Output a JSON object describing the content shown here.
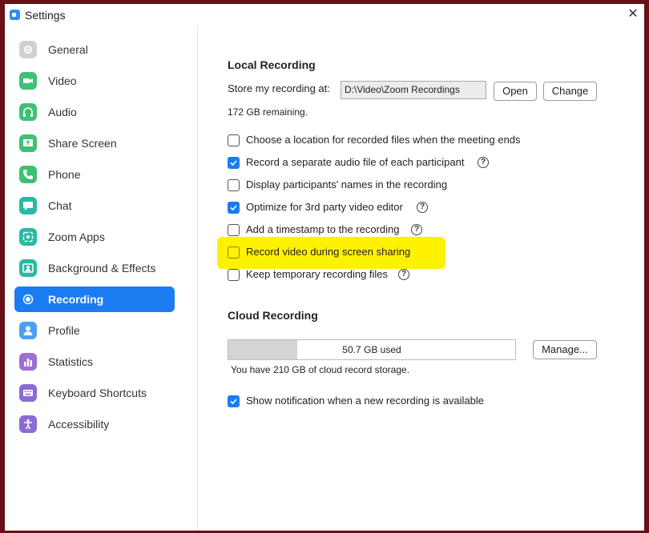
{
  "window": {
    "title": "Settings",
    "close_symbol": "✕"
  },
  "sidebar": {
    "items": [
      {
        "label": "General",
        "icon": "gear-icon",
        "color": "#c9c9c9"
      },
      {
        "label": "Video",
        "icon": "video-camera-icon",
        "color": "#3ec173"
      },
      {
        "label": "Audio",
        "icon": "headphones-icon",
        "color": "#3ec173"
      },
      {
        "label": "Share Screen",
        "icon": "share-screen-icon",
        "color": "#3ec173"
      },
      {
        "label": "Phone",
        "icon": "phone-icon",
        "color": "#3ec173"
      },
      {
        "label": "Chat",
        "icon": "chat-bubble-icon",
        "color": "#2bb9a3"
      },
      {
        "label": "Zoom Apps",
        "icon": "apps-icon",
        "color": "#2bb9a3"
      },
      {
        "label": "Background & Effects",
        "icon": "background-icon",
        "color": "#2bb9a3"
      },
      {
        "label": "Recording",
        "icon": "record-icon",
        "color": "#ffffff",
        "active": true
      },
      {
        "label": "Profile",
        "icon": "profile-icon",
        "color": "#4aa0f5"
      },
      {
        "label": "Statistics",
        "icon": "statistics-icon",
        "color": "#a06ed1"
      },
      {
        "label": "Keyboard Shortcuts",
        "icon": "keyboard-icon",
        "color": "#8a6bd6"
      },
      {
        "label": "Accessibility",
        "icon": "accessibility-icon",
        "color": "#8a6bd6"
      }
    ]
  },
  "local_recording": {
    "title": "Local Recording",
    "store_label": "Store my recording at:",
    "path": "D:\\Video\\Zoom Recordings",
    "open_label": "Open",
    "change_label": "Change",
    "remaining": "172 GB remaining.",
    "options": [
      {
        "label": "Choose a location for recorded files when the meeting ends",
        "checked": false,
        "help": false
      },
      {
        "label": "Record a separate audio file of each participant",
        "checked": true,
        "help": true
      },
      {
        "label": "Display participants' names in the recording",
        "checked": false,
        "help": false
      },
      {
        "label": "Optimize for 3rd party video editor",
        "checked": true,
        "help": true
      },
      {
        "label": "Add a timestamp to the recording",
        "checked": false,
        "help": true
      },
      {
        "label": "Record video during screen sharing",
        "checked": false,
        "help": false,
        "highlighted": true
      },
      {
        "label": "Keep temporary recording files",
        "checked": false,
        "help": true
      }
    ]
  },
  "cloud_recording": {
    "title": "Cloud Recording",
    "used_text": "50.7 GB used",
    "used_fraction": 0.24,
    "manage_label": "Manage...",
    "storage_text": "You have 210 GB of cloud record storage.",
    "notification": {
      "label": "Show notification when a new recording is available",
      "checked": true
    }
  },
  "help_symbol": "?",
  "colors": {
    "accent": "#1b7cf1",
    "highlight": "#fff200",
    "frame": "#6b0f17"
  }
}
